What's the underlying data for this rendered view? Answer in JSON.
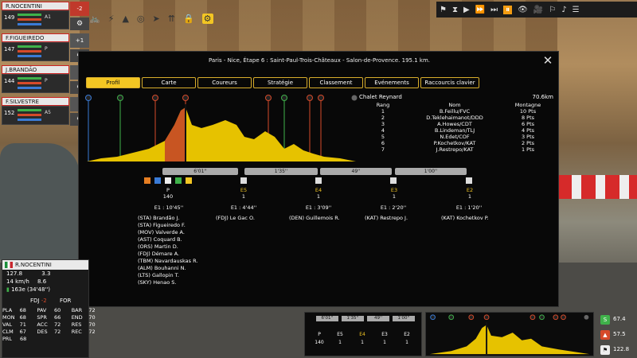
{
  "riders": [
    {
      "name": "R.NOCENTINI",
      "num": "149",
      "tag": "A1",
      "delta": "-2",
      "delta_class": "red"
    },
    {
      "name": "F.FIGUEIREDO",
      "num": "147",
      "tag": "P",
      "delta": "+1",
      "delta_class": "gray"
    },
    {
      "name": "J.BRANDÃO",
      "num": "144",
      "tag": "P",
      "delta": "",
      "delta_class": "gray"
    },
    {
      "name": "F.SILVESTRE",
      "num": "152",
      "tag": "A5",
      "delta": "",
      "delta_class": "gray"
    }
  ],
  "modal": {
    "title": "Paris - Nice, Étape 6 : Saint-Paul-Trois-Châteaux - Salon-de-Provence. 195.1 km.",
    "close": "✕",
    "tabs": [
      "Profil",
      "Carte",
      "Coureurs",
      "Stratégie",
      "Classement",
      "Evénements",
      "Raccourcis clavier"
    ]
  },
  "climb": {
    "name": "Chalet Reynard",
    "distance": "70.6km",
    "headers": [
      "Rang",
      "Nom",
      "Montagne"
    ],
    "rows": [
      [
        "1",
        "B.Feillu/FVC",
        "10 Pts"
      ],
      [
        "2",
        "D.Teklehaimanot/DDD",
        "8 Pts"
      ],
      [
        "3",
        "A.Howes/CDT",
        "6 Pts"
      ],
      [
        "4",
        "B.Lindeman/TLJ",
        "4 Pts"
      ],
      [
        "5",
        "N.Edet/COF",
        "3 Pts"
      ],
      [
        "6",
        "P.Kochetkov/KAT",
        "2 Pts"
      ],
      [
        "7",
        "J.Restrepo/KAT",
        "1 Pts"
      ]
    ]
  },
  "strips": [
    "6'01''",
    "1'35''",
    "49''",
    "1'00''"
  ],
  "groups": [
    {
      "code": "P",
      "count": "140",
      "time": "E1 : 10'45''"
    },
    {
      "code": "E5",
      "count": "1",
      "time": "E1 : 4'44''"
    },
    {
      "code": "E4",
      "count": "1",
      "time": "E1 : 3'09''"
    },
    {
      "code": "E3",
      "count": "1",
      "time": "E1 : 2'20''"
    },
    {
      "code": "E2",
      "count": "1",
      "time": "E1 : 1'20''"
    }
  ],
  "peloton": [
    "(STA) Brandão J.",
    "(STA) Figueiredo F.",
    "(MOV) Valverde A.",
    "(AST) Coquard B.",
    "(ORS) Martin D.",
    "(FDJ) Démare A.",
    "(TBM) Navardauskas R.",
    "(ALM) Bouhanni N.",
    "(LTS) Gallopin T.",
    "(SKY) Henao S."
  ],
  "escapees": [
    "(FDJ) Le Gac O.",
    "(DEN) Guillemois R.",
    "(KAT) Restrepo J.",
    "(KAT) Kochetkov P."
  ],
  "selected": {
    "name": "R.NOCENTINI",
    "speed": "127.8",
    "power": "14 km/h",
    "gradient": "3.3",
    "elev": "8.6",
    "position": "163e (34'48'')"
  },
  "team": {
    "label": "FDJ",
    "delta": "-2",
    "side": "FOR"
  },
  "stats": [
    [
      "PLA",
      "68",
      "PAV",
      "60",
      "BAR",
      "72"
    ],
    [
      "MON",
      "68",
      "SPR",
      "66",
      "END",
      "70"
    ],
    [
      "VAL",
      "71",
      "ACC",
      "72",
      "RES",
      "70"
    ],
    [
      "CLM",
      "67",
      "DES",
      "72",
      "REC",
      "72"
    ],
    [
      "PRL",
      "68",
      "",
      "",
      "",
      ""
    ]
  ],
  "mini": {
    "strips": [
      "6'01''",
      "1'35''",
      "49''",
      "1'00''"
    ],
    "codes": [
      "P",
      "E5",
      "E4",
      "E3",
      "E2"
    ],
    "counts": [
      "140",
      "1",
      "1",
      "1",
      "1"
    ]
  },
  "right_stats": [
    "67.4",
    "57.5",
    "122.8"
  ],
  "colors": {
    "accent": "#f3c623",
    "profile_yellow": "#e6c200",
    "sprint_green": "#3fb24a",
    "climb_red": "#d64a2a"
  }
}
